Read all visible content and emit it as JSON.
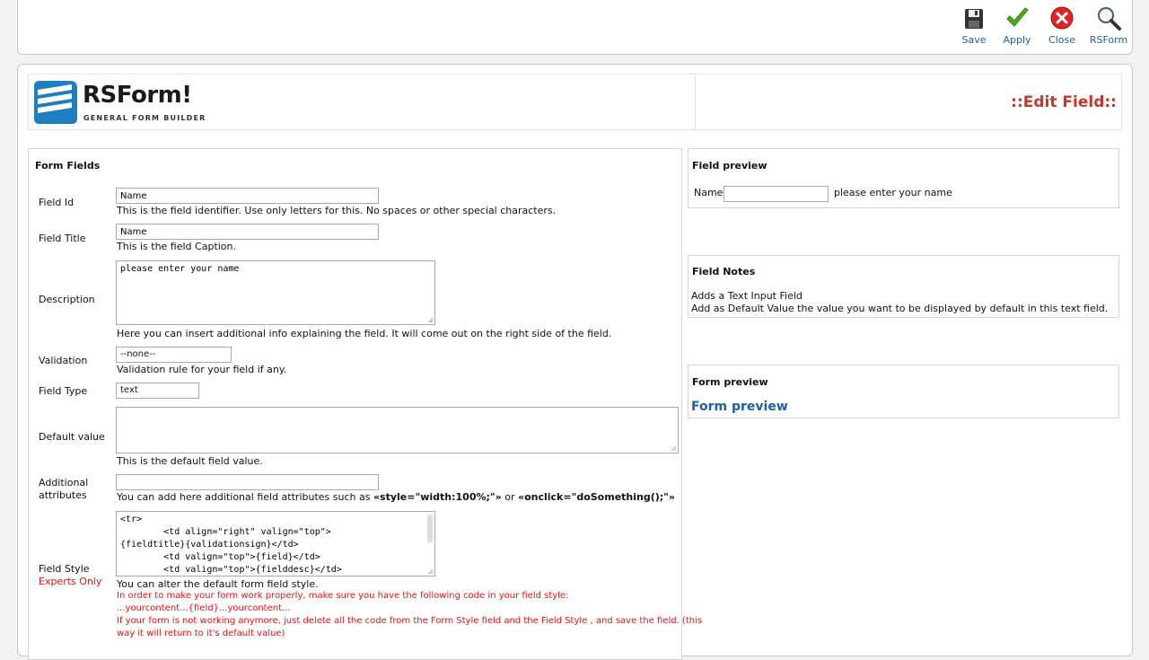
{
  "toolbar": {
    "save_label": "Save",
    "apply_label": "Apply",
    "close_label": "Close",
    "rsform_label": "RSForm"
  },
  "header": {
    "logo_text": "RSForm!",
    "logo_subtitle": "GENERAL FORM BUILDER",
    "page_title": "::Edit Field::"
  },
  "form_fields": {
    "title": "Form Fields",
    "field_id": {
      "label": "Field Id",
      "value": "Name",
      "hint": "This is the field identifier. Use only letters for this. No spaces or other special characters."
    },
    "field_title": {
      "label": "Field Title",
      "value": "Name",
      "hint": "This is the field Caption."
    },
    "description": {
      "label": "Description",
      "value": "please enter your name",
      "hint": "Here you can insert additional info explaining the field. It will come out on the right side of the field."
    },
    "validation": {
      "label": "Validation",
      "value": "--none--",
      "hint": "Validation rule for your field if any."
    },
    "field_type": {
      "label": "Field Type",
      "value": "text"
    },
    "default_value": {
      "label": "Default value",
      "value": "",
      "hint": "This is the default field value."
    },
    "additional_attributes": {
      "label": "Additional attributes",
      "value": "",
      "hint_prefix": "You can add here additional field attributes such as ",
      "hint_code1": "«style=\"width:100%;\"»",
      "hint_mid": " or ",
      "hint_code2": "«onclick=\"doSomething();\"»"
    },
    "field_style": {
      "label": "Field Style",
      "sublabel": "Experts Only",
      "value": "<tr>\n        <td align=\"right\" valign=\"top\">\n{fieldtitle}{validationsign}</td>\n        <td valign=\"top\">{field}</td>\n        <td valign=\"top\">{fielddesc}</td>",
      "hint": "You can alter the default form field style.",
      "warning1": "In order to make your form work properly, make sure you have the following code in your field style:",
      "warning2": "...yourcontent...{field}...yourcontent...",
      "warning3": "If your form is not working anymore, just delete all the code from the Form Style field and the Field Style , and save the field. (this",
      "warning4": "way it will return to it's default value)"
    }
  },
  "field_preview": {
    "title": "Field preview",
    "label": "Name",
    "value": "",
    "description": "please enter your name"
  },
  "field_notes": {
    "title": "Field Notes",
    "line1": "Adds a Text Input Field",
    "line2": "Add as Default Value the value you want to be displayed by default in this text field."
  },
  "form_preview": {
    "title": "Form preview",
    "link_label": "Form preview"
  },
  "colors": {
    "accent_blue": "#1f5fa8",
    "title_red": "#c0392b",
    "warning_red": "#e11111"
  }
}
